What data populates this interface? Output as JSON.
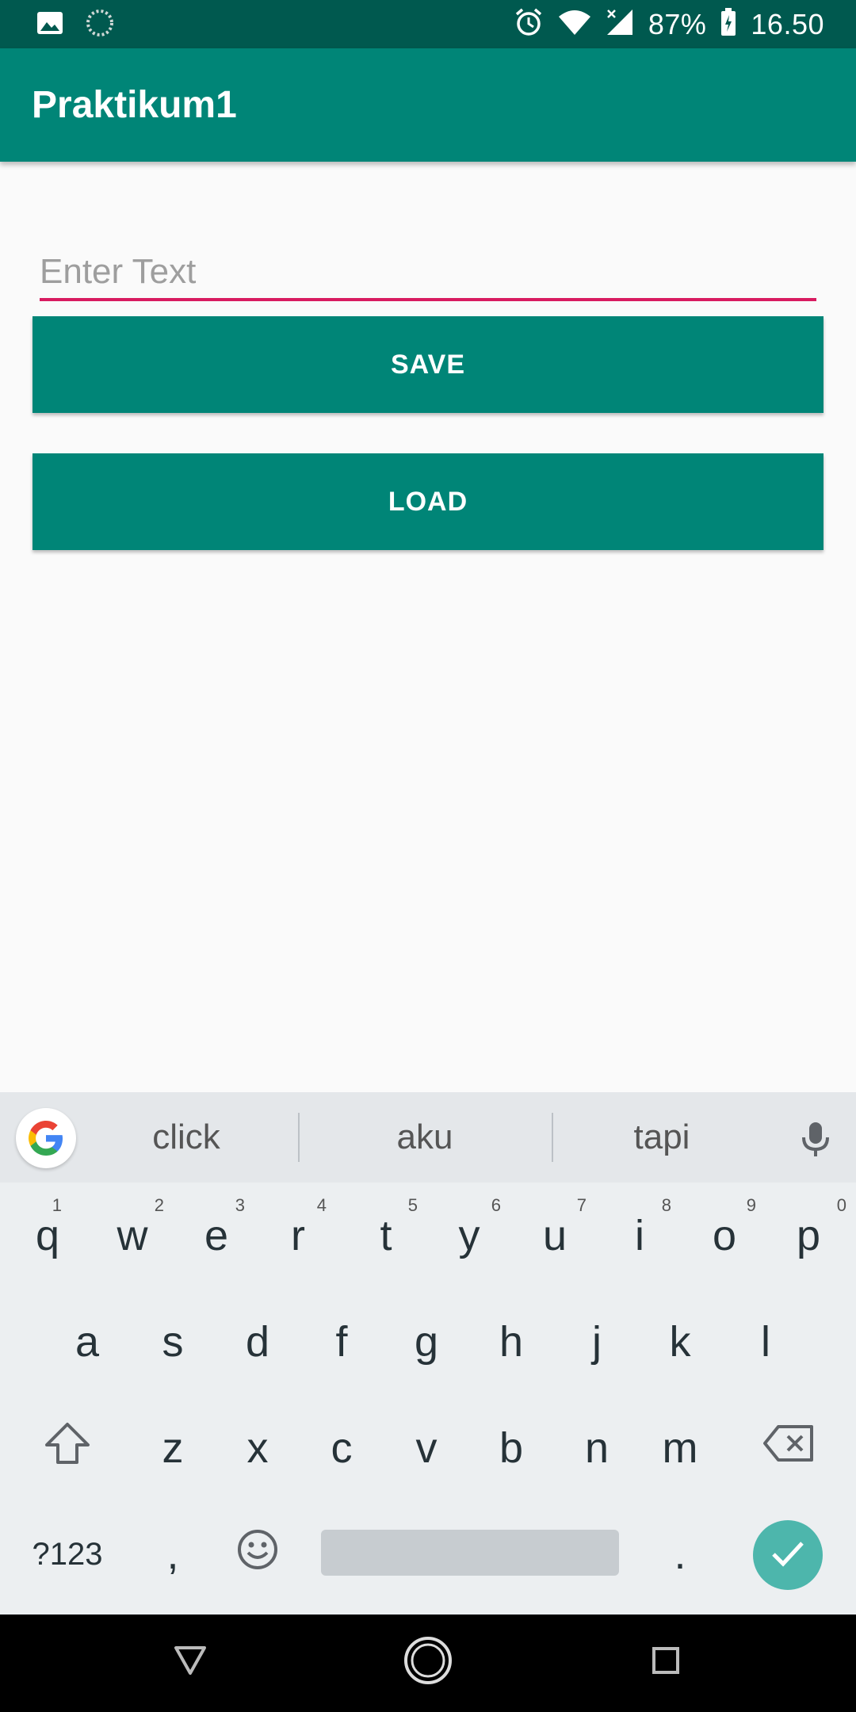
{
  "status_bar": {
    "left_icons": [
      "image-icon",
      "sync-icon"
    ],
    "right_icons": [
      "alarm-icon",
      "wifi-icon",
      "signal-icon"
    ],
    "battery": "87%",
    "time": "16.50"
  },
  "app_bar": {
    "title": "Praktikum1"
  },
  "form": {
    "input": {
      "placeholder": "Enter Text",
      "value": ""
    },
    "save_label": "SAVE",
    "load_label": "LOAD"
  },
  "keyboard": {
    "suggestions": [
      "click",
      "aku",
      "tapi"
    ],
    "row1": [
      {
        "k": "q",
        "n": "1"
      },
      {
        "k": "w",
        "n": "2"
      },
      {
        "k": "e",
        "n": "3"
      },
      {
        "k": "r",
        "n": "4"
      },
      {
        "k": "t",
        "n": "5"
      },
      {
        "k": "y",
        "n": "6"
      },
      {
        "k": "u",
        "n": "7"
      },
      {
        "k": "i",
        "n": "8"
      },
      {
        "k": "o",
        "n": "9"
      },
      {
        "k": "p",
        "n": "0"
      }
    ],
    "row2": [
      "a",
      "s",
      "d",
      "f",
      "g",
      "h",
      "j",
      "k",
      "l"
    ],
    "row3": [
      "z",
      "x",
      "c",
      "v",
      "b",
      "n",
      "m"
    ],
    "symbols_label": "?123",
    "comma_label": ",",
    "period_label": "."
  },
  "colors": {
    "status_bar": "#00594f",
    "primary": "#008577",
    "accent": "#d81b60",
    "enter_key": "#4db6ac"
  }
}
